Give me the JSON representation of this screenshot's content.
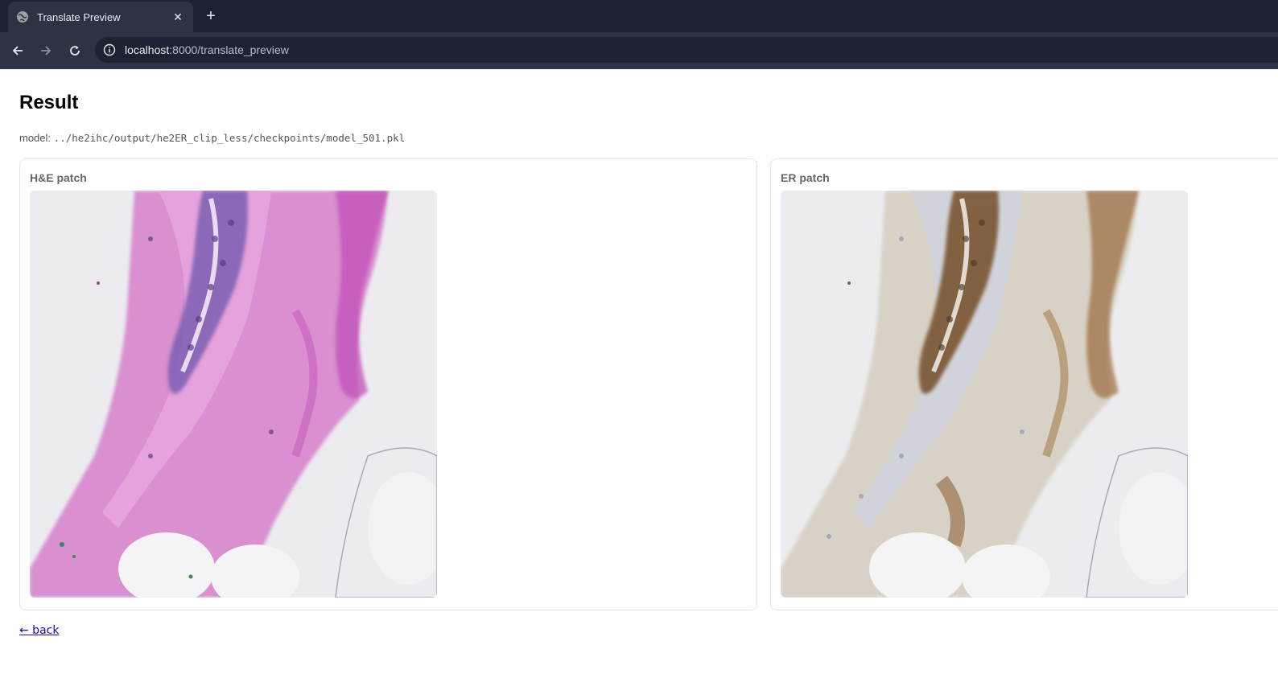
{
  "browser": {
    "tab_title": "Translate Preview",
    "tab_close": "✕",
    "new_tab": "+",
    "url_host": "localhost",
    "url_path": ":8000/translate_preview"
  },
  "page": {
    "title": "Result",
    "model_label": "model:",
    "model_path": "../he2ihc/output/he2ER_clip_less/checkpoints/model_501.pkl",
    "panels": [
      {
        "label": "H&E patch",
        "image_icon": "he-stain-tissue-image"
      },
      {
        "label": "ER patch",
        "image_icon": "er-ihc-tissue-image"
      }
    ],
    "back_link": "← back"
  },
  "colors": {
    "chrome_dark": "#1b2333",
    "chrome_toolbar": "#2a3445",
    "link": "#1a0dab",
    "he_stain": "#c86fc0",
    "er_stain": "#8a5a2b"
  }
}
